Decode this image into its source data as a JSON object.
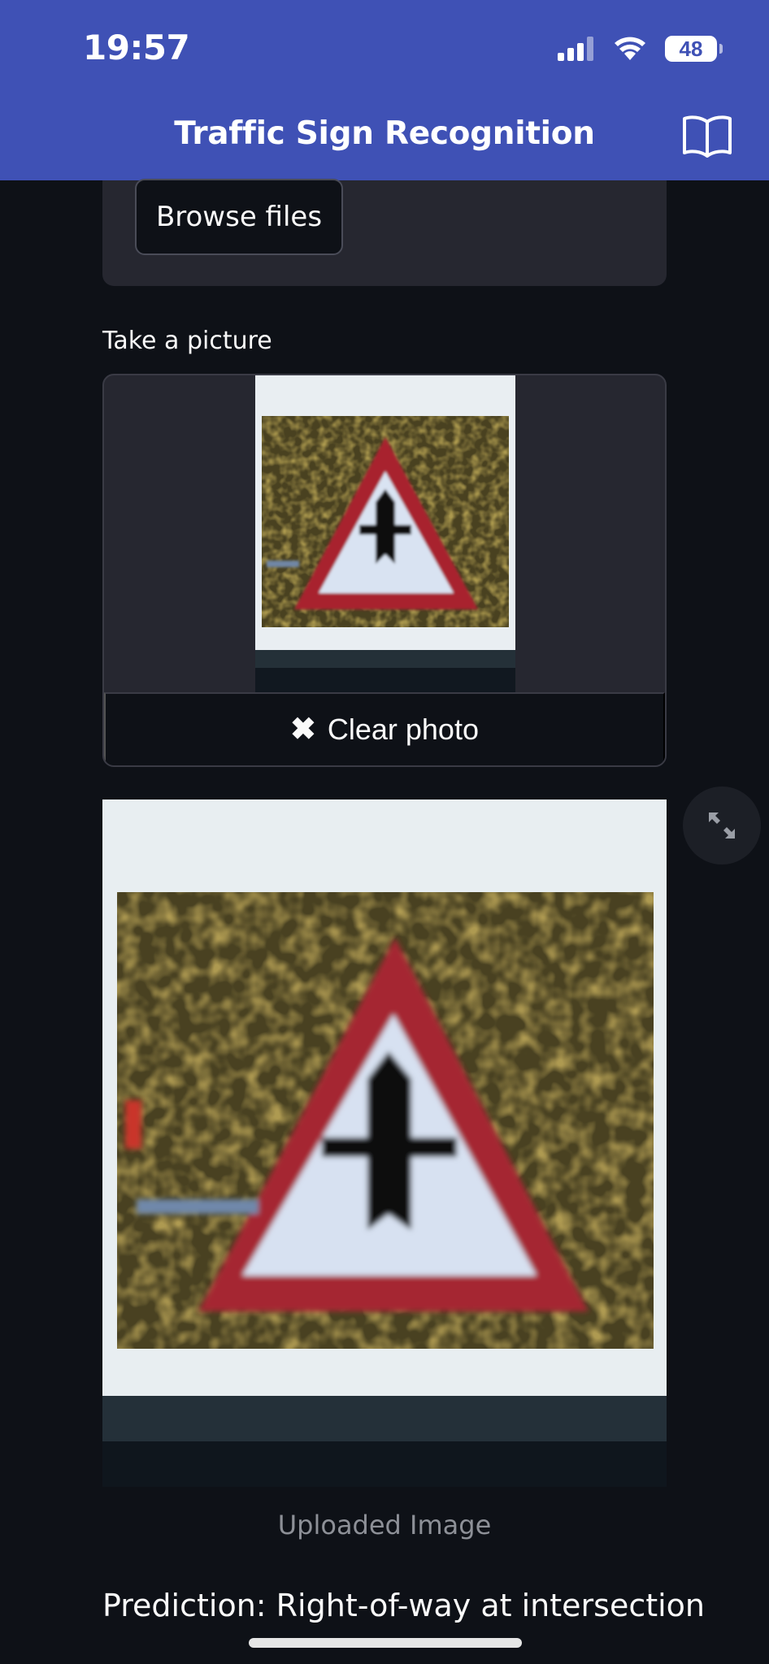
{
  "status_bar": {
    "time": "19:57",
    "battery": "48",
    "icons": [
      "signal-icon",
      "wifi-icon",
      "battery-icon"
    ]
  },
  "header": {
    "title": "Traffic Sign Recognition",
    "icon": "book-icon",
    "color": "#3f51b5"
  },
  "uploader": {
    "browse_label": "Browse files"
  },
  "camera": {
    "label": "Take a picture",
    "clear_label": "Clear photo",
    "clear_icon": "close-icon"
  },
  "image": {
    "fullscreen_icon": "expand-icon",
    "caption": "Uploaded Image"
  },
  "result": {
    "prediction": "Prediction: Right-of-way at intersection"
  },
  "theme": {
    "background": "#0e1117",
    "card": "#262730",
    "text": "#fafafa",
    "muted": "#8d9097"
  }
}
